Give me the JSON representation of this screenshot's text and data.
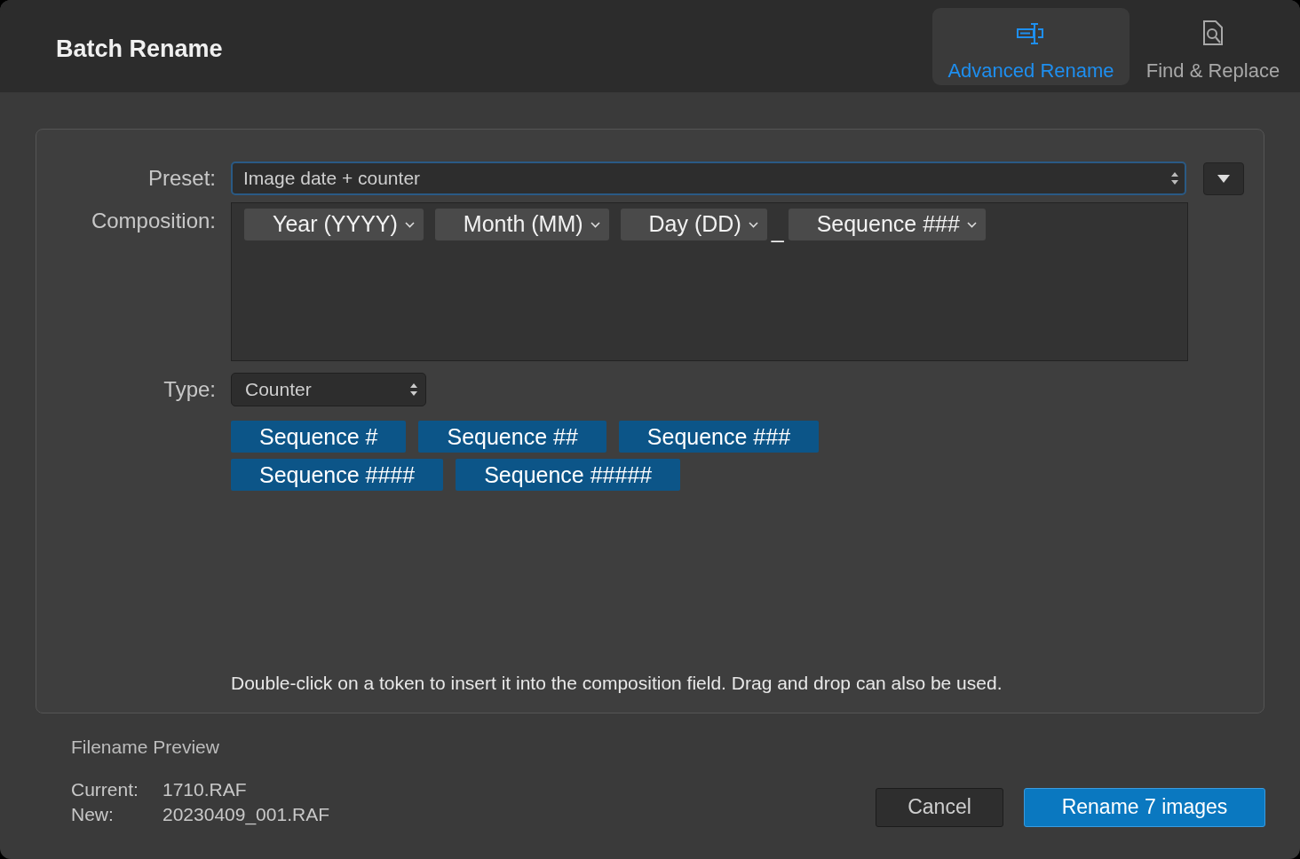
{
  "window": {
    "title": "Batch Rename"
  },
  "tabs": [
    {
      "label": "Advanced Rename",
      "kind": "rename",
      "selected": true
    },
    {
      "label": "Find & Replace",
      "kind": "find",
      "selected": false
    }
  ],
  "preset": {
    "label": "Preset:",
    "value": "Image date + counter"
  },
  "composition": {
    "label": "Composition:",
    "items": [
      {
        "kind": "token",
        "label": "Year (YYYY)"
      },
      {
        "kind": "token",
        "label": "Month (MM)"
      },
      {
        "kind": "token",
        "label": "Day (DD)"
      },
      {
        "kind": "separator",
        "label": "_"
      },
      {
        "kind": "token",
        "label": "Sequence ###"
      }
    ]
  },
  "type": {
    "label": "Type:",
    "value": "Counter"
  },
  "token_palette": [
    [
      "Sequence #",
      "Sequence ##",
      "Sequence ###"
    ],
    [
      "Sequence ####",
      "Sequence #####"
    ]
  ],
  "hint": "Double-click on a token to insert it into the composition field. Drag and drop can also be used.",
  "preview": {
    "title": "Filename Preview",
    "rows": [
      {
        "label": "Current:",
        "value": "1710.RAF"
      },
      {
        "label": "New:",
        "value": "20230409_001.RAF"
      }
    ]
  },
  "buttons": [
    {
      "label": "Cancel",
      "kind": "secondary"
    },
    {
      "label": "Rename 7 images",
      "kind": "primary"
    }
  ]
}
